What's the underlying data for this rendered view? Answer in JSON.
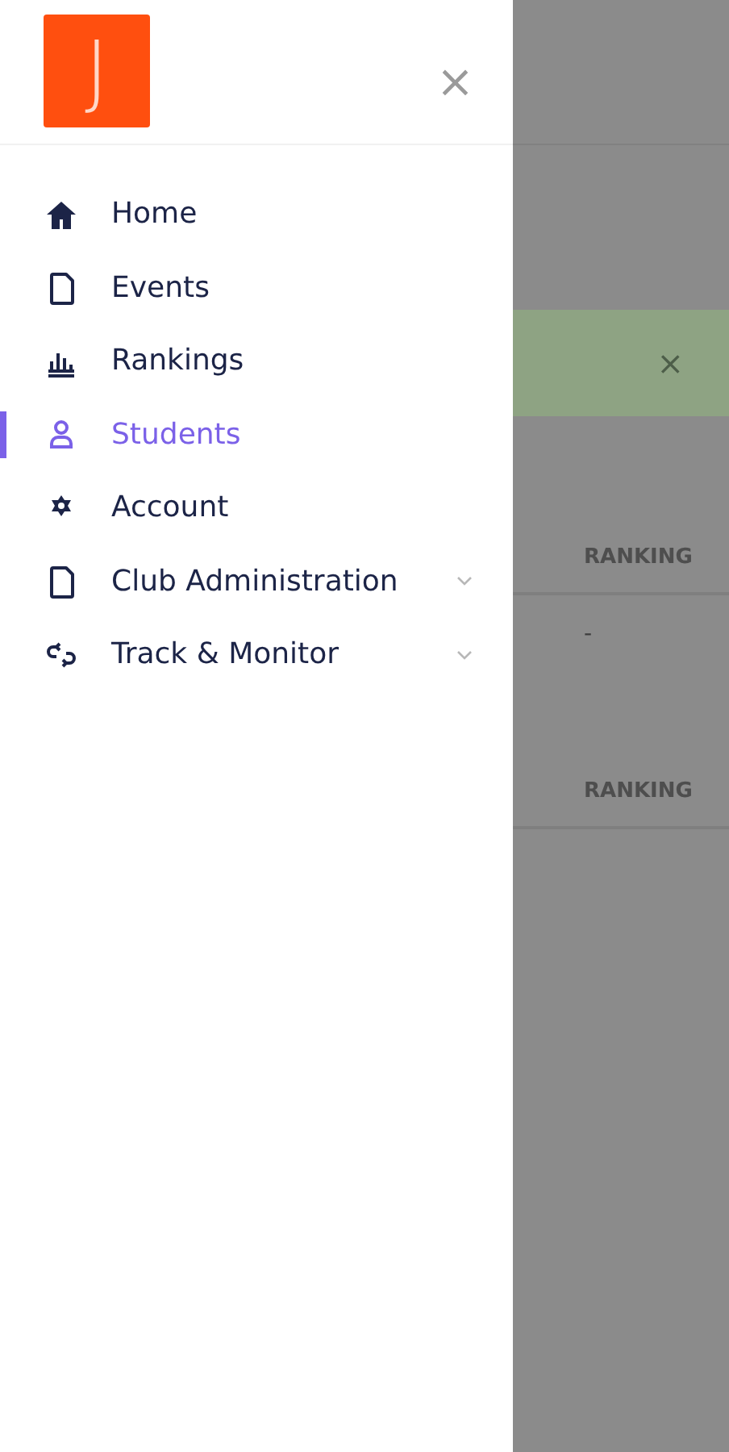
{
  "drawer": {
    "logo_letter": "J",
    "close": "×",
    "menu": [
      {
        "label": "Home",
        "kind": "home",
        "selected": false,
        "expandable": false
      },
      {
        "label": "Events",
        "kind": "file",
        "selected": false,
        "expandable": false
      },
      {
        "label": "Rankings",
        "kind": "chart",
        "selected": false,
        "expandable": false
      },
      {
        "label": "Students",
        "kind": "person",
        "selected": true,
        "expandable": false
      },
      {
        "label": "Account",
        "kind": "gear",
        "selected": false,
        "expandable": false
      },
      {
        "label": "Club Administration",
        "kind": "file",
        "selected": false,
        "expandable": true
      },
      {
        "label": "Track & Monitor",
        "kind": "cycle",
        "selected": false,
        "expandable": true
      }
    ]
  },
  "background": {
    "alert": {
      "close": "×"
    },
    "tables": [
      {
        "columns": [
          "RANKING"
        ],
        "rows": [
          [
            "-"
          ]
        ]
      },
      {
        "columns": [
          "RANKING"
        ]
      }
    ]
  }
}
